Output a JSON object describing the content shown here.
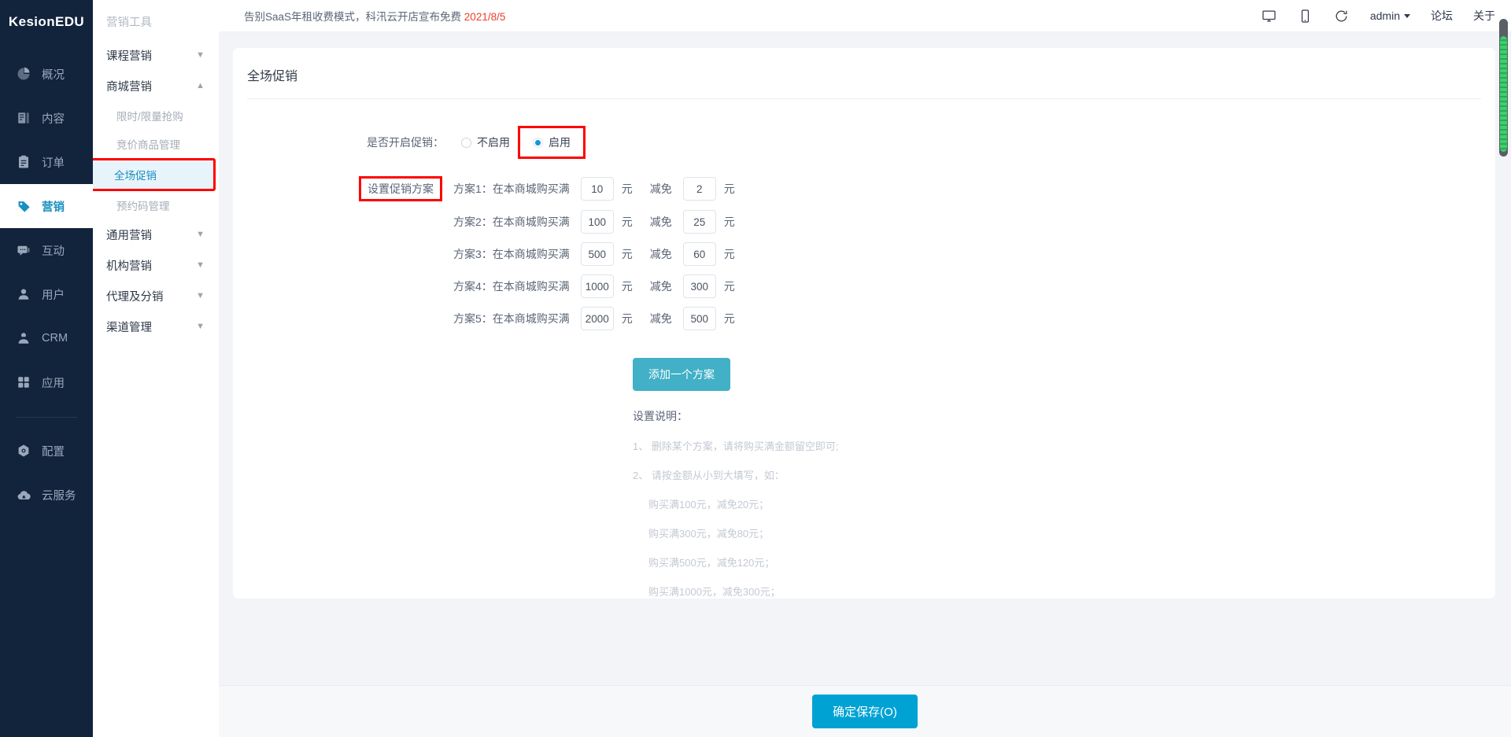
{
  "brand": {
    "name": "KesionEDU"
  },
  "rail": {
    "items": [
      {
        "label": "概况",
        "icon": "pie-chart-icon",
        "active": false
      },
      {
        "label": "内容",
        "icon": "content-list-icon",
        "active": false
      },
      {
        "label": "订单",
        "icon": "clipboard-icon",
        "active": false
      },
      {
        "label": "营销",
        "icon": "tag-icon",
        "active": true
      },
      {
        "label": "互动",
        "icon": "chat-icon",
        "active": false
      },
      {
        "label": "用户",
        "icon": "user-icon",
        "active": false
      },
      {
        "label": "CRM",
        "icon": "crm-user-icon",
        "active": false
      },
      {
        "label": "应用",
        "icon": "grid-apps-icon",
        "active": false
      },
      {
        "label": "配置",
        "icon": "gear-icon",
        "active": false
      },
      {
        "label": "云服务",
        "icon": "cloud-icon",
        "active": false
      }
    ]
  },
  "submenu": {
    "title": "营销工具",
    "groups": [
      {
        "label": "课程营销",
        "expanded": false,
        "children": []
      },
      {
        "label": "商城营销",
        "expanded": true,
        "children": [
          {
            "label": "限时/限量抢购",
            "active": false
          },
          {
            "label": "竞价商品管理",
            "active": false
          },
          {
            "label": "全场促销",
            "active": true
          },
          {
            "label": "预约码管理",
            "active": false
          }
        ]
      },
      {
        "label": "通用营销",
        "expanded": false,
        "children": []
      },
      {
        "label": "机构营销",
        "expanded": false,
        "children": []
      },
      {
        "label": "代理及分销",
        "expanded": false,
        "children": []
      },
      {
        "label": "渠道管理",
        "expanded": false,
        "children": []
      }
    ]
  },
  "topbar": {
    "notice_text": "告别SaaS年租收费模式，科汛云开店宣布免费",
    "notice_date": "2021/8/5",
    "icons": [
      "desktop-icon",
      "mobile-icon",
      "refresh-icon"
    ],
    "user": "admin",
    "links": [
      "论坛",
      "关于"
    ]
  },
  "page": {
    "title": "全场促销",
    "enable_label": "是否开启促销：",
    "radio_off": "不启用",
    "radio_on": "启用",
    "selected_radio": "启用",
    "plan_badge": "设置促销方案",
    "cut_label": "减免",
    "unit": "元",
    "plans": [
      {
        "text": "方案1：在本商城购买满",
        "amount": "10",
        "discount": "2"
      },
      {
        "text": "方案2：在本商城购买满",
        "amount": "100",
        "discount": "25"
      },
      {
        "text": "方案3：在本商城购买满",
        "amount": "500",
        "discount": "60"
      },
      {
        "text": "方案4：在本商城购买满",
        "amount": "1000",
        "discount": "300"
      },
      {
        "text": "方案5：在本商城购买满",
        "amount": "2000",
        "discount": "500"
      }
    ],
    "add_plan_button": "添加一个方案",
    "help_title": "设置说明：",
    "help_lines": [
      "1、 删除某个方案，请将购买满金额留空即可;",
      "2、 请按金额从小到大填写，如："
    ],
    "help_examples": [
      "购买满100元，减免20元；",
      "购买满300元，减免80元；",
      "购买满500元，减免120元；",
      "购买满1000元，减免300元；"
    ],
    "save_button": "确定保存(O)"
  },
  "colors": {
    "rail_bg": "#12243c",
    "accent": "#1a8fc1",
    "save_button": "#00a2d4",
    "add_button": "#42b0c6",
    "highlight_box": "#ff0000",
    "notice_date": "#e8412c",
    "page_bg": "#f2f4f7"
  }
}
